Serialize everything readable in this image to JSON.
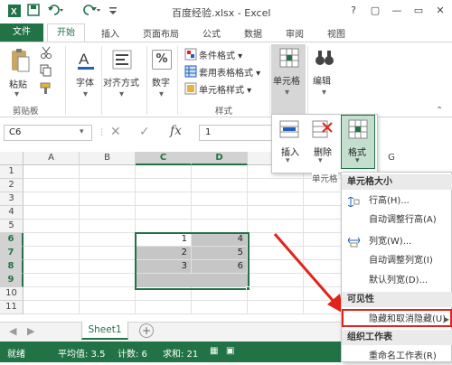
{
  "window": {
    "title": "百度经验.xlsx - Excel",
    "controls": [
      "?",
      "▢",
      "—",
      "▭",
      "✕"
    ]
  },
  "tabs": [
    "文件",
    "开始",
    "插入",
    "页面布局",
    "公式",
    "数据",
    "审阅",
    "视图"
  ],
  "ribbon": {
    "clipboard": {
      "paste": "粘贴",
      "group": "剪贴板"
    },
    "font": "字体",
    "alignment": "对齐方式",
    "number": "数字",
    "number_symbol": "%",
    "styles": {
      "items": [
        "条件格式 ▾",
        "套用表格格式 ▾",
        "单元格样式 ▾"
      ],
      "group": "样式"
    },
    "cells": "单元格",
    "editing": "编辑"
  },
  "cells_panel": {
    "insert": "插入",
    "delete": "删除",
    "format": "格式",
    "group": "单元格"
  },
  "formula_bar": {
    "name_box": "C6",
    "cancel": "✕",
    "enter": "✓",
    "fx": "fx",
    "value": "1"
  },
  "grid": {
    "columns": [
      "A",
      "B",
      "C",
      "D",
      "G"
    ],
    "rows": [
      "1",
      "2",
      "3",
      "4",
      "5",
      "6",
      "7",
      "8",
      "9",
      "10",
      "11"
    ],
    "data": {
      "C6": "1",
      "D6": "4",
      "C7": "2",
      "D7": "5",
      "C8": "3",
      "D8": "6"
    }
  },
  "sheets": [
    "Sheet1"
  ],
  "status": {
    "mode": "就绪",
    "average": "平均值: 3.5",
    "count": "计数: 6",
    "sum": "求和: 21"
  },
  "format_menu": {
    "section_size": "单元格大小",
    "row_height": "行高(H)...",
    "autofit_row": "自动调整行高(A)",
    "col_width": "列宽(W)...",
    "autofit_col": "自动调整列宽(I)",
    "default_width": "默认列宽(D)...",
    "section_visibility": "可见性",
    "hide_unhide": "隐藏和取消隐藏(U)",
    "section_organize": "组织工作表",
    "rename": "重命名工作表(R)"
  },
  "colors": {
    "accent": "#217346",
    "highlight": "#e2231a"
  }
}
